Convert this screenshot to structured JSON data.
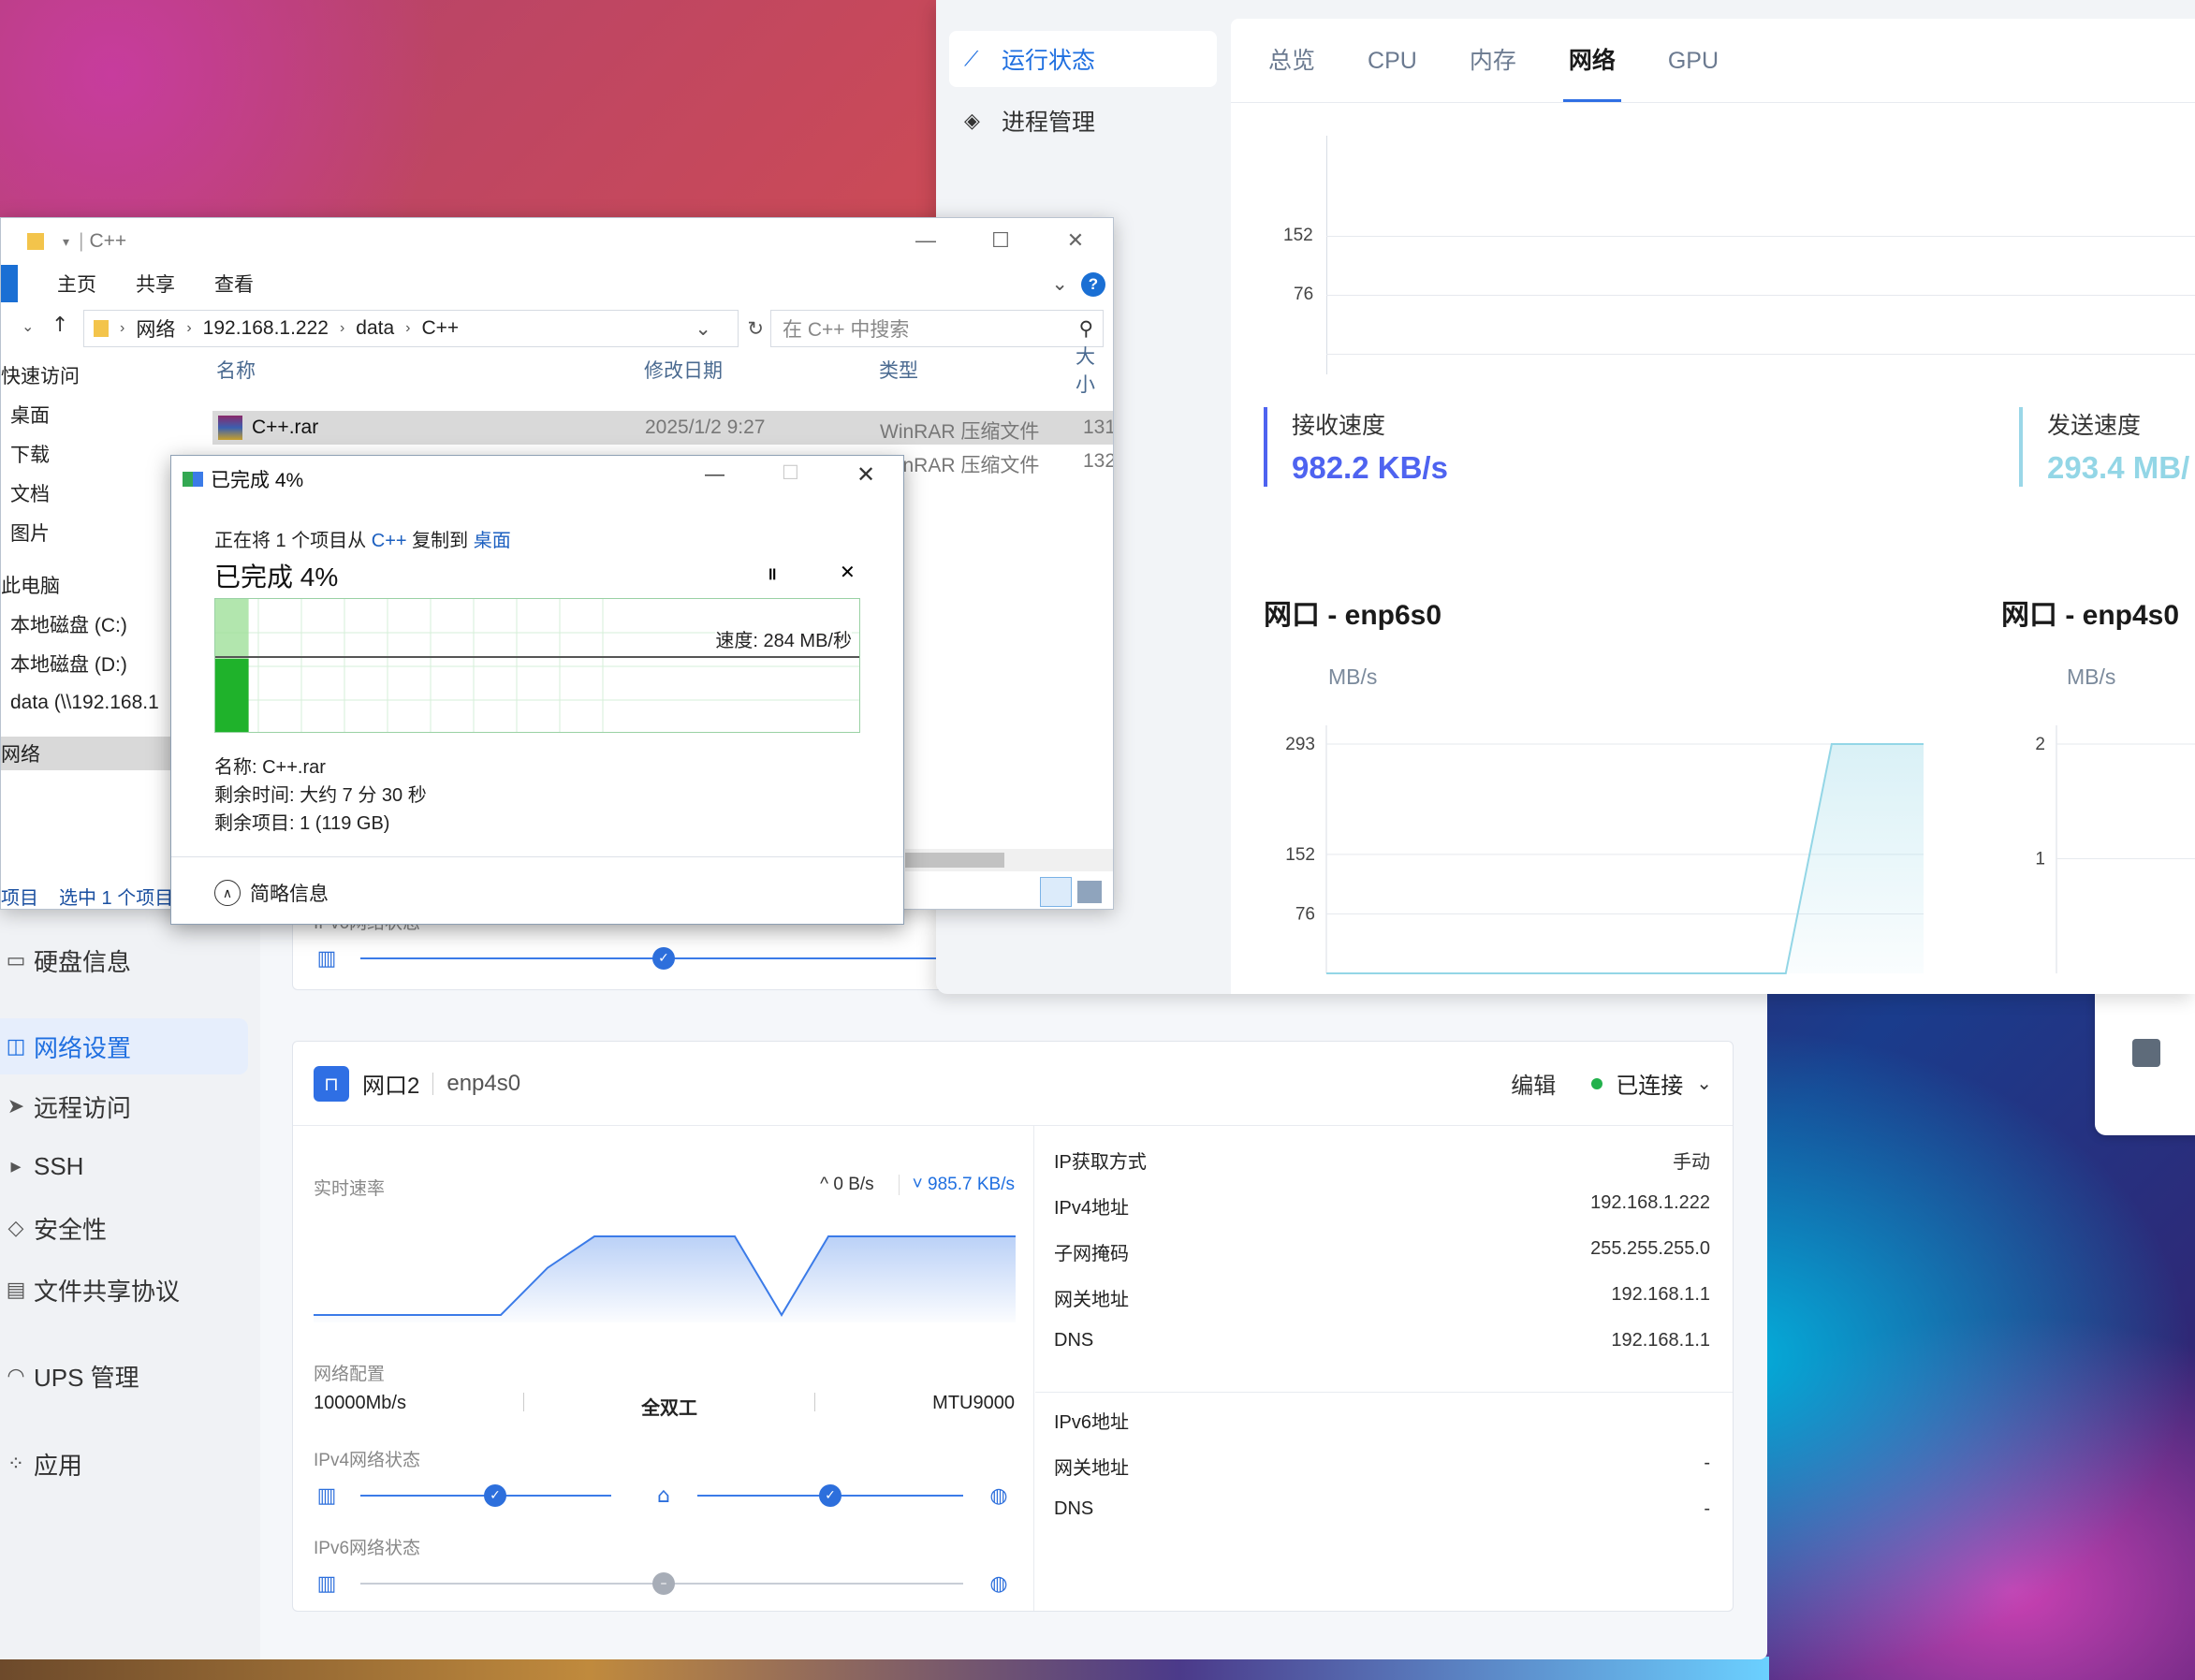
{
  "nas": {
    "sidebar": [
      {
        "label": "硬盘信息",
        "icon": "disk-icon"
      },
      {
        "label": "网络设置",
        "icon": "network-icon",
        "active": true
      },
      {
        "label": "远程访问",
        "icon": "send-icon"
      },
      {
        "label": "SSH",
        "icon": "terminal-icon"
      },
      {
        "label": "安全性",
        "icon": "shield-icon"
      },
      {
        "label": "文件共享协议",
        "icon": "file-share-icon"
      },
      {
        "label": "UPS 管理",
        "icon": "ups-icon"
      },
      {
        "label": "应用",
        "icon": "apps-icon"
      }
    ],
    "card1": {
      "ipv6_label": "IPv6网络状态"
    },
    "card2": {
      "name": "网口2",
      "device": "enp4s0",
      "edit": "编辑",
      "status": "已连接",
      "realtime_label": "实时速率",
      "up_speed": "0 B/s",
      "down_speed": "985.7 KB/s",
      "config_label": "网络配置",
      "link_speed": "10000Mb/s",
      "duplex": "全双工",
      "mtu": "MTU9000",
      "ipv4_state_label": "IPv4网络状态",
      "ipv6_state_label": "IPv6网络状态",
      "details": [
        {
          "k": "IP获取方式",
          "v": "手动"
        },
        {
          "k": "IPv4地址",
          "v": "192.168.1.222"
        },
        {
          "k": "子网掩码",
          "v": "255.255.255.0"
        },
        {
          "k": "网关地址",
          "v": "192.168.1.1"
        },
        {
          "k": "DNS",
          "v": "192.168.1.1"
        }
      ],
      "details6": [
        {
          "k": "IPv6地址",
          "v": ""
        },
        {
          "k": "网关地址",
          "v": "-"
        },
        {
          "k": "DNS",
          "v": "-"
        }
      ],
      "realtime_series": [
        0.0,
        0.0,
        0.0,
        0.0,
        0.0,
        0.6,
        1.0,
        1.0,
        1.0,
        1.0,
        0.0,
        1.0,
        1.0,
        1.0,
        1.0,
        1.0
      ]
    }
  },
  "monitor": {
    "nav": [
      {
        "label": "运行状态",
        "icon": "chart-line-icon",
        "active": true
      },
      {
        "label": "进程管理",
        "icon": "layers-icon"
      }
    ],
    "tabs": [
      "总览",
      "CPU",
      "内存",
      "网络",
      "GPU"
    ],
    "active_tab": "网络",
    "top_ticks": [
      "152",
      "76"
    ],
    "recv_label": "接收速度",
    "recv_value": "982.2 KB/s",
    "send_label": "发送速度",
    "send_value": "293.4 MB/",
    "if1_title": "网口 - enp6s0",
    "if2_title": "网口 - enp4s0",
    "unit": "MB/s",
    "colors": {
      "recv": "#4e63f0",
      "send": "#93d6e6",
      "accent": "#2f6fe4"
    }
  },
  "chart_data": [
    {
      "type": "line",
      "title": "网口 - enp6s0",
      "ylabel": "MB/s",
      "yticks": [
        293,
        152,
        76
      ],
      "series": [
        {
          "values": [
            0,
            0,
            0,
            0,
            0,
            0,
            0,
            0,
            0,
            0,
            0,
            293,
            293,
            293
          ]
        }
      ]
    },
    {
      "type": "line",
      "title": "网口 - enp4s0",
      "ylabel": "MB/s",
      "yticks": [
        2,
        1
      ],
      "series": []
    }
  ],
  "explorer": {
    "title": "C++",
    "ribbon_tabs": [
      "主页",
      "共享",
      "查看"
    ],
    "address": [
      "网络",
      "192.168.1.222",
      "data",
      "C++"
    ],
    "search_placeholder": "在 C++ 中搜索",
    "nav": [
      "快速访问",
      "桌面",
      "下载",
      "文档",
      "图片",
      "此电脑",
      "本地磁盘 (C:)",
      "本地磁盘 (D:)",
      "data (\\\\192.168.1",
      "网络"
    ],
    "columns": [
      "名称",
      "修改日期",
      "类型",
      "大小"
    ],
    "rows": [
      {
        "name": "C++.rar",
        "date": "2025/1/2 9:27",
        "type": "WinRAR 压缩文件",
        "size": "131"
      },
      {
        "name": "",
        "date": "",
        "type": "WinRAR 压缩文件",
        "size": "132"
      }
    ],
    "status_items": "项目",
    "status_selected": "选中 1 个项目"
  },
  "copy": {
    "title": "已完成 4%",
    "line_prefix": "正在将 1 个项目从 ",
    "from": "C++",
    "middle": " 复制到 ",
    "to": "桌面",
    "big": "已完成 4%",
    "speed": "速度: 284 MB/秒",
    "name_line": "名称: C++.rar",
    "remaining_time": "剩余时间: 大约 7 分 30 秒",
    "remaining_items": "剩余项目: 1 (119 GB)",
    "brief": "简略信息",
    "progress": 0.04
  }
}
